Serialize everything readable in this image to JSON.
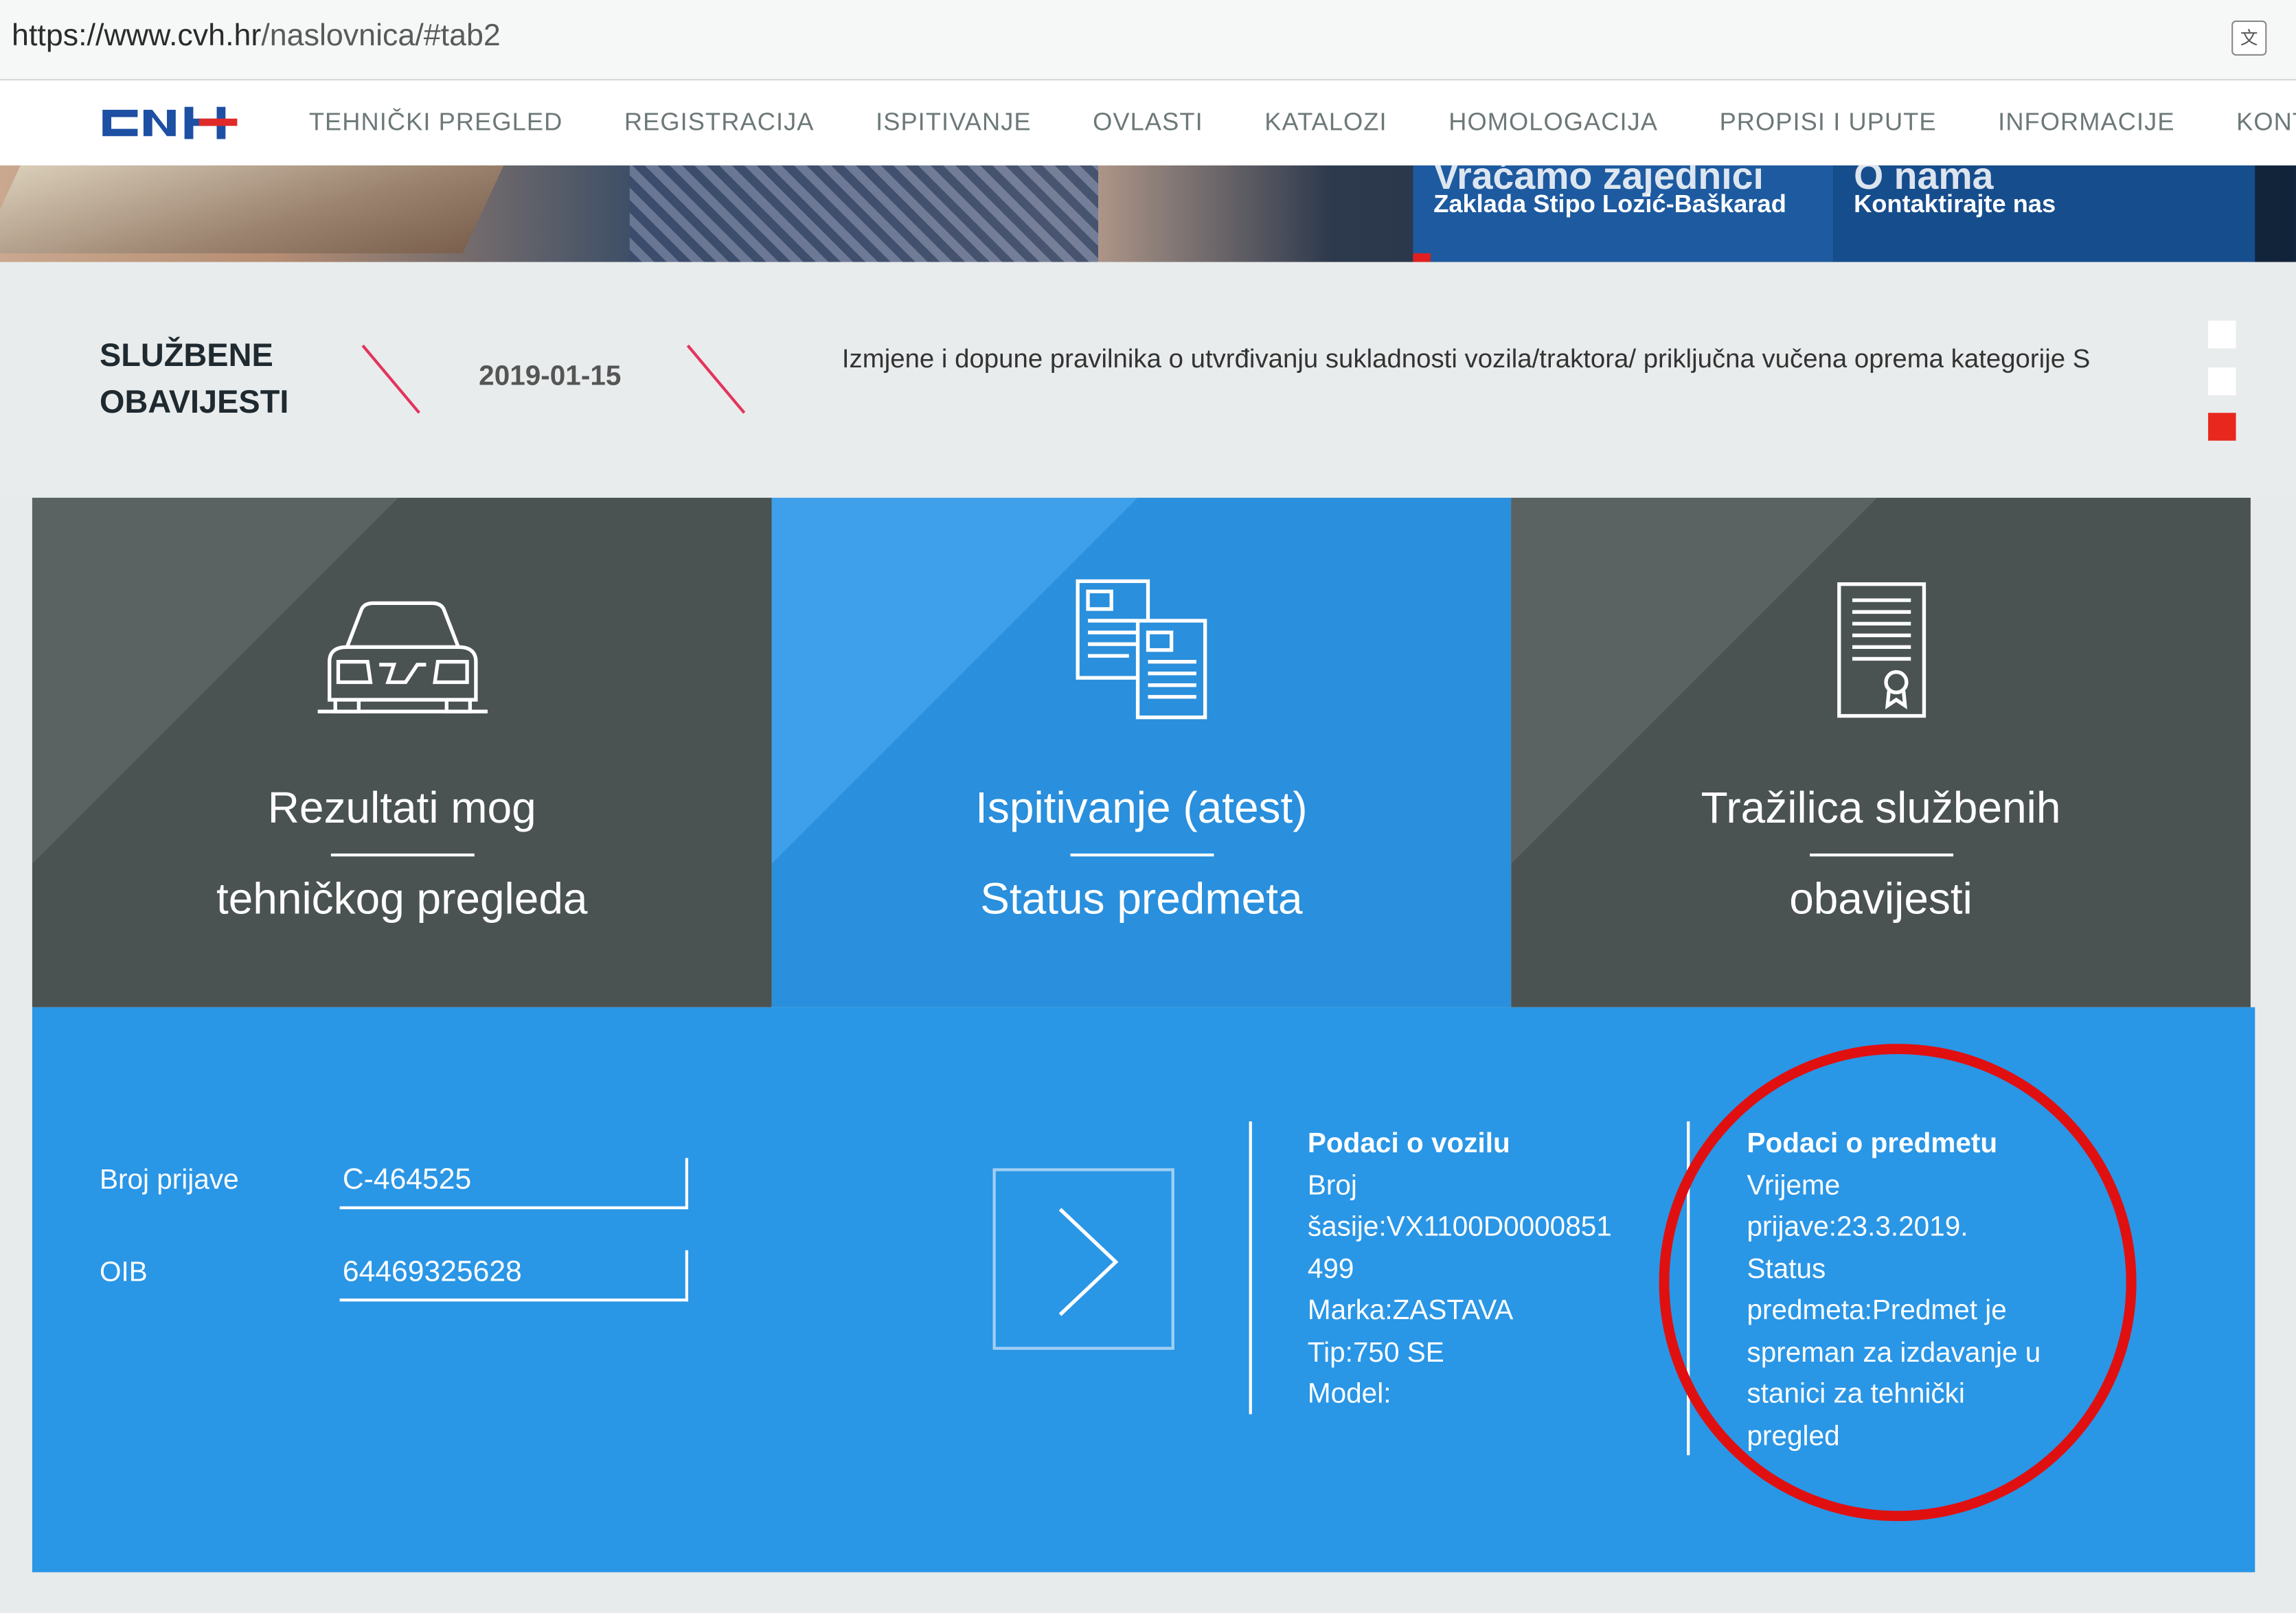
{
  "browser": {
    "url_prefix": "https://www.cvh.hr",
    "url_path": "/naslovnica/#tab2",
    "translate_icon": "translate-icon"
  },
  "nav": {
    "logo_text": "CVH",
    "items": [
      {
        "label": "TEHNIČKI PREGLED"
      },
      {
        "label": "REGISTRACIJA"
      },
      {
        "label": "ISPITIVANJE"
      },
      {
        "label": "OVLASTI"
      },
      {
        "label": "KATALOZI"
      },
      {
        "label": "HOMOLOGACIJA"
      },
      {
        "label": "PROPISI I UPUTE"
      },
      {
        "label": "INFORMACIJE"
      },
      {
        "label": "KONTAKT"
      }
    ]
  },
  "hero": {
    "card1_title": "Vraćamo zajednici",
    "card1_sub": "Zaklada Stipo Lozić-Baškarad",
    "card2_title": "O nama",
    "card2_sub": "Kontaktirajte nas"
  },
  "notices": {
    "title_line1": "SLUŽBENE",
    "title_line2": "OBAVIJESTI",
    "date": "2019-01-15",
    "text": "Izmjene i dopune pravilnika o utvrđivanju sukladnosti vozila/traktora/ priključna vučena oprema kategorije S",
    "dot_colors": [
      "#ffffff",
      "#ffffff",
      "#e8281e"
    ]
  },
  "tiles": [
    {
      "line1": "Rezultati mog",
      "line2": "tehničkog pregleda",
      "icon": "car-icon"
    },
    {
      "line1": "Ispitivanje (atest)",
      "line2": "Status predmeta",
      "icon": "documents-icon"
    },
    {
      "line1": "Tražilica službenih",
      "line2": "obavijesti",
      "icon": "certificate-icon"
    }
  ],
  "form": {
    "broj_label": "Broj prijave",
    "broj_value": "C-464525",
    "oib_label": "OIB",
    "oib_value": "64469325628",
    "submit_icon": "chevron-right-icon"
  },
  "vehicle": {
    "heading": "Podaci o vozilu",
    "lines": [
      "Broj",
      "šasije:VX1100D0000851",
      "499",
      "Marka:ZASTAVA",
      "Tip:750 SE",
      "Model:"
    ]
  },
  "case": {
    "heading": "Podaci o predmetu",
    "lines": [
      "Vrijeme",
      "prijave:23.3.2019.",
      "Status",
      "predmeta:Predmet je",
      "spreman za izdavanje u",
      "stanici za tehnički",
      "pregled"
    ]
  },
  "colors": {
    "accent_blue": "#2a96e6",
    "tile_dark": "#4a5252",
    "highlight_red": "#e01010",
    "nav_text": "#6d7878"
  }
}
